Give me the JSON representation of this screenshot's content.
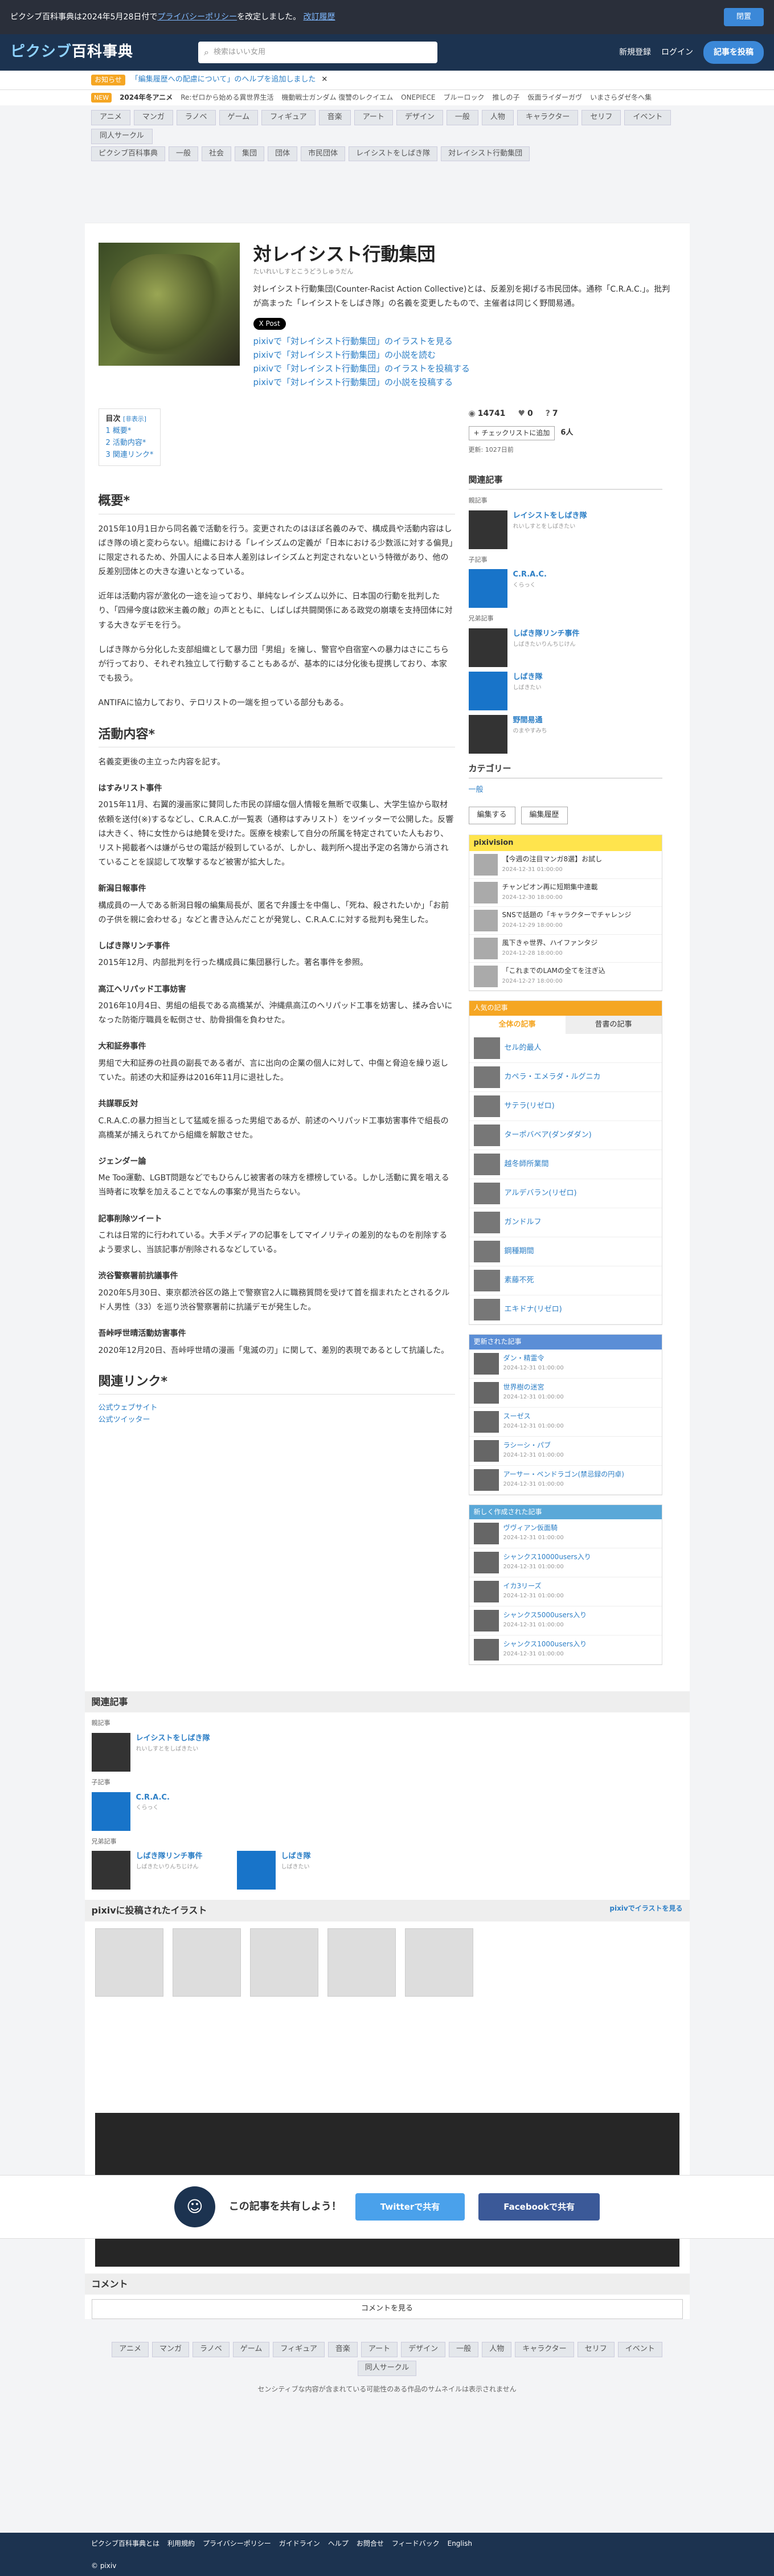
{
  "topbar": {
    "message_prefix": "ピクシブ百科事典は2024年5月28日付で",
    "policy_link": "プライバシーポリシー",
    "message_suffix": "を改定しました。",
    "history_link": "改訂履歴",
    "close": "閉置"
  },
  "header": {
    "logo_a": "ピクシブ",
    "logo_b": "百科事典",
    "search_placeholder": "検索はいい女用",
    "new_items": "新規登録",
    "login": "ログイン",
    "create": "記事を投稿"
  },
  "notice": {
    "tag": "お知らせ",
    "text": "「編集履歴への配慮について」のヘルプを追加しました",
    "close": "✕"
  },
  "trend": {
    "new": "NEW",
    "label": "2024年冬アニメ",
    "items": [
      "Re:ゼロから始める異世界生活",
      "機動戦士ガンダム 復讐のレクイエム",
      "ONEPIECE",
      "ブルーロック",
      "推しの子",
      "仮面ライダーガヴ",
      "いまさらダゼ冬へ集"
    ]
  },
  "cats": [
    "アニメ",
    "マンガ",
    "ラノベ",
    "ゲーム",
    "フィギュア",
    "音楽",
    "アート",
    "デザイン",
    "一般",
    "人物",
    "キャラクター",
    "セリフ",
    "イベント",
    "同人サークル"
  ],
  "cats2": [
    "ピクシブ百科事典",
    "一般",
    "社会",
    "集団",
    "団体",
    "市民団体",
    "レイシストをしばき隊",
    "対レイシスト行動集団"
  ],
  "article": {
    "title": "対レイシスト行動集団",
    "reading": "たいれいしすとこうどうしゅうだん",
    "summary": "対レイシスト行動集団(Counter-Racist Action Collective)とは、反差別を掲げる市民団体。通称「C.R.A.C.」。批判が高まった「レイシストをしばき隊」の名義を変更したもので、主催者は同じく野間易通。",
    "xpost": "X Post",
    "plinks": [
      "pixivで「対レイシスト行動集団」のイラストを見る",
      "pixivで「対レイシスト行動集団」の小説を読む",
      "pixivで「対レイシスト行動集団」のイラストを投稿する",
      "pixivで「対レイシスト行動集団」の小説を投稿する"
    ]
  },
  "toc": {
    "title": "目次",
    "toggle": "[非表示]",
    "items": [
      "1 概要*",
      "2 活動内容*",
      "3 関連リンク*"
    ]
  },
  "sections": {
    "overview": {
      "h": "概要*",
      "p": [
        "2015年10月1日から同名義で活動を行う。変更されたのはほぼ名義のみで、構成員や活動内容はしばき隊の頃と変わらない。組織における「レイシズムの定義が「日本における少数派に対する偏見」に限定されるため、外国人による日本人差別はレイシズムと判定されないという特徴があり、他の反差別団体との大きな違いとなっている。",
        "近年は活動内容が激化の一途を辿っており、単純なレイシズム以外に、日本国の行動を批判したり、「四帰今度は欧米主義の敵」の声とともに、しばしば共闘関係にある政党の崩壊を支持団体に対する大きなデモを行う。",
        "しばき隊から分化した支部組織として暴力団「男組」を擁し、警官や自宿室への暴力はさにこちらが行っており、それぞれ独立して行動することもあるが、基本的には分化後も提携しており、本家でも扱う。",
        "ANTIFAに協力しており、テロリストの一端を担っている部分もある。"
      ]
    },
    "activity": {
      "h": "活動内容*",
      "intro": "名義変更後の主立った内容を記す。",
      "items": [
        {
          "h": "はすみリスト事件",
          "p": "2015年11月、右翼的漫画家に賛同した市民の詳細な個人情報を無断で収集し、大学生協から取材依頼を送付(※)するなどし、C.R.A.C.が一覧表（通称はすみリスト）をツイッターで公開した。反響は大きく、特に女性からは絶賛を受けた。医療を検索して自分の所属を特定されていた人もおり、リスト掲載者へは嫌がらせの電話が殺到しているが、しかし、裁判所へ提出予定の名簿から消されていることを誤認して攻撃するなど被害が拡大した。"
        },
        {
          "h": "新潟日報事件",
          "p": "構成員の一人である新潟日報の編集局長が、匿名で弁護士を中傷し、「死ね、殺されたいか」「お前の子供を親に会わせる」などと書き込んだことが発覚し、C.R.A.C.に対する批判も発生した。"
        },
        {
          "h": "しばき隊リンチ事件",
          "p": "2015年12月、内部批判を行った構成員に集団暴行した。著名事件を参照。"
        },
        {
          "h": "高江ヘリパッド工事妨害",
          "p": "2016年10月4日、男組の組長である高橋某が、沖縄県高江のヘリパッド工事を妨害し、揉み合いになった防衛庁職員を転倒させ、肋骨損傷を負わせた。"
        },
        {
          "h": "大和証券事件",
          "p": "男組で大和証券の社員の副長である者が、言に出向の企業の個人に対して、中傷と脅迫を繰り返していた。前述の大和証券は2016年11月に退社した。"
        },
        {
          "h": "共謀罪反対",
          "p": "C.R.A.C.の暴力担当として猛威を振るった男組であるが、前述のヘリパッド工事妨害事件で組長の高橋某が捕えられてから組織を解散させた。"
        },
        {
          "h": "ジェンダー論",
          "p": "Me Too運動、LGBT問題などでもひらんじ被害者の味方を標榜している。しかし活動に異を唱える当時者に攻撃を加えることでなんの事案が見当たらない。"
        },
        {
          "h": "記事削除ツイート",
          "p": "これは日常的に行われている。大手メディアの記事をしてマイノリティの差別的なものを削除するよう要求し、当該記事が削除されるなどしている。"
        },
        {
          "h": "渋谷警察署前抗議事件",
          "p": "2020年5月30日、東京都渋谷区の路上で警察官2人に職務質問を受けて首を掴まれたとされるクルド人男性（33）を巡り渋谷警察署前に抗議デモが発生した。"
        },
        {
          "h": "吾峠呼世晴活動妨害事件",
          "p": "2020年12月20日、吾峠呼世晴の漫画「鬼滅の刃」に関して、差別的表現であるとして抗議した。"
        }
      ]
    },
    "links": {
      "h": "関連リンク*",
      "items": [
        "公式ウェブサイト",
        "公式ツイッター"
      ]
    }
  },
  "side": {
    "views": "14741",
    "likes": "0",
    "questions": "7",
    "check_label": "+ チェックリストに追加",
    "check_count": "6人",
    "updated": "更新: 1027日前",
    "rel_title": "関連記事",
    "rel_parent": "親記事",
    "rel_child": "子記事",
    "rel_sib": "兄弟記事",
    "rel_items": [
      {
        "n": "レイシストをしばき隊",
        "r": "れいしすとをしばきたい"
      },
      {
        "n": "C.R.A.C.",
        "r": "くらっく"
      },
      {
        "n": "しばき隊リンチ事件",
        "r": "しばきたいりんちじけん"
      },
      {
        "n": "しばき隊",
        "r": "しばきたい"
      },
      {
        "n": "野間易通",
        "r": "のまやすみち"
      }
    ],
    "cat_title": "カテゴリー",
    "cat_value": "一般",
    "edit": "編集する",
    "history": "編集履歴",
    "pixivision": "pixivision",
    "pv_items": [
      {
        "t": "【今週の注目マンガ8選】お試し",
        "d": "2024-12-31 01:00:00"
      },
      {
        "t": "チャンピオン再に短期集中連載",
        "d": "2024-12-30 18:00:00"
      },
      {
        "t": "SNSで話題の「キャラクターでチャレンジ",
        "d": "2024-12-29 18:00:00"
      },
      {
        "t": "風下きゃ世界、ハイファンタジ",
        "d": "2024-12-28 18:00:00"
      },
      {
        "t": "「これまでのLAMの全てを注ぎ込",
        "d": "2024-12-27 18:00:00"
      }
    ],
    "pop_hd": "人気の記事",
    "pop_tab1": "全体の記事",
    "pop_tab2": "昔書の記事",
    "pop_items": [
      "セル的最人",
      "カペラ・エメラダ・ルグニカ",
      "サテラ(リゼロ)",
      "ターポバベア(ダンダダン)",
      "越冬師所業間",
      "アルデバラン(リゼロ)",
      "ガンドルフ",
      "鋼種期間",
      "素藤不死",
      "エキドナ(リゼロ)"
    ],
    "new_hd": "更新された記事",
    "new_items": [
      {
        "t": "ダン・精霊令",
        "d": "2024-12-31 01:00:00"
      },
      {
        "t": "世界樹の迷宮",
        "d": "2024-12-31 01:00:00"
      },
      {
        "t": "スーゼス",
        "d": "2024-12-31 01:00:00"
      },
      {
        "t": "ラシーシ・パブ",
        "d": "2024-12-31 01:00:00"
      },
      {
        "t": "アーサー・ペンドラゴン(禁忌録の円卓)",
        "d": "2024-12-31 01:00:00"
      }
    ],
    "new2_hd": "新しく作成された記事",
    "new2_items": [
      {
        "t": "ヴヴィアン仮面騎",
        "d": "2024-12-31 01:00:00"
      },
      {
        "t": "シャンクス10000users入り",
        "d": "2024-12-31 01:00:00"
      },
      {
        "t": "イカ3リーズ",
        "d": "2024-12-31 01:00:00"
      },
      {
        "t": "シャンクス5000users入り",
        "d": "2024-12-31 01:00:00"
      },
      {
        "t": "シャンクス1000users入り",
        "d": "2024-12-31 01:00:00"
      }
    ]
  },
  "lower": {
    "rel_title": "関連記事",
    "illust_title": "pixivに投稿されたイラスト",
    "illust_link": "pixivでイラストを見る",
    "comment_title": "コメント",
    "comment_btn": "コメントを見る"
  },
  "share": {
    "q": "この記事を共有しよう！",
    "tw": "Twitterで共有",
    "fb": "Facebookで共有"
  },
  "safe": "センシティブな内容が含まれている可能性のある作品のサムネイルは表示されません",
  "footer": {
    "links": [
      "ピクシブ百科事典とは",
      "利用規約",
      "プライバシーポリシー",
      "利用規約",
      "ガイドライン",
      "ヘルプ",
      "お問合せ",
      "フィードバック",
      "English"
    ],
    "copy": "© pixiv"
  }
}
